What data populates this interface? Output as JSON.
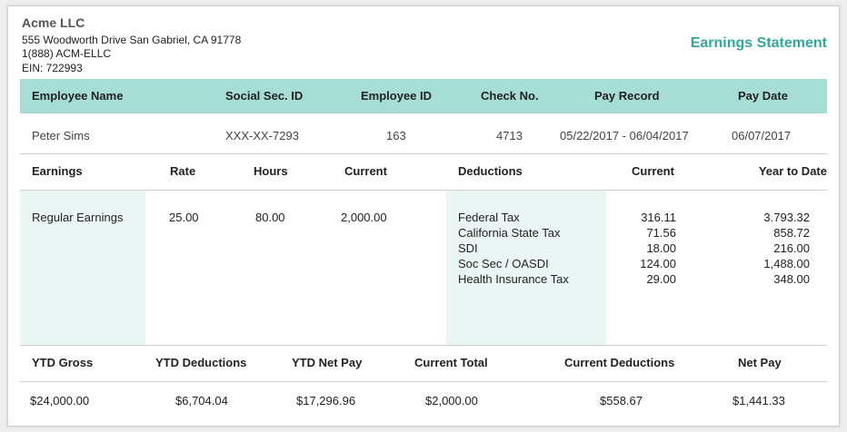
{
  "company": {
    "name": "Acme LLC",
    "address": "555 Woodworth Drive San Gabriel, CA  91778",
    "phone": "1(888) ACM-ELLC",
    "ein": "EIN: 722993"
  },
  "statement_title": "Earnings Statement",
  "colors": {
    "accent": "#34a79c",
    "band": "#a6ddd5",
    "shade": "#eaf6f4"
  },
  "employee_table": {
    "headers": [
      "Employee Name",
      "Social Sec. ID",
      "Employee ID",
      "Check No.",
      "Pay Record",
      "Pay Date"
    ],
    "row": [
      "Peter Sims",
      "XXX-XX-7293",
      "163",
      "4713",
      "05/22/2017 - 06/04/2017",
      "06/07/2017"
    ]
  },
  "earnings": {
    "headers": [
      "Earnings",
      "Rate",
      "Hours",
      "Current"
    ],
    "row": {
      "label": "Regular Earnings",
      "rate": "25.00",
      "hours": "80.00",
      "current": "2,000.00"
    }
  },
  "deductions": {
    "headers": [
      "Deductions",
      "Current",
      "Year to Date"
    ],
    "items": [
      {
        "name": "Federal Tax",
        "current": "316.11",
        "ytd": "3.793.32"
      },
      {
        "name": "California State Tax",
        "current": "71.56",
        "ytd": "858.72"
      },
      {
        "name": "SDI",
        "current": "18.00",
        "ytd": "216.00"
      },
      {
        "name": "Soc Sec / OASDI",
        "current": "124.00",
        "ytd": "1,488.00"
      },
      {
        "name": "Health Insurance Tax",
        "current": "29.00",
        "ytd": "348.00"
      }
    ]
  },
  "totals": {
    "headers": [
      "YTD Gross",
      "YTD Deductions",
      "YTD Net Pay",
      "Current Total",
      "Current Deductions",
      "Net Pay"
    ],
    "values": [
      "$24,000.00",
      "$6,704.04",
      "$17,296.96",
      "$2,000.00",
      "$558.67",
      "$1,441.33"
    ]
  }
}
